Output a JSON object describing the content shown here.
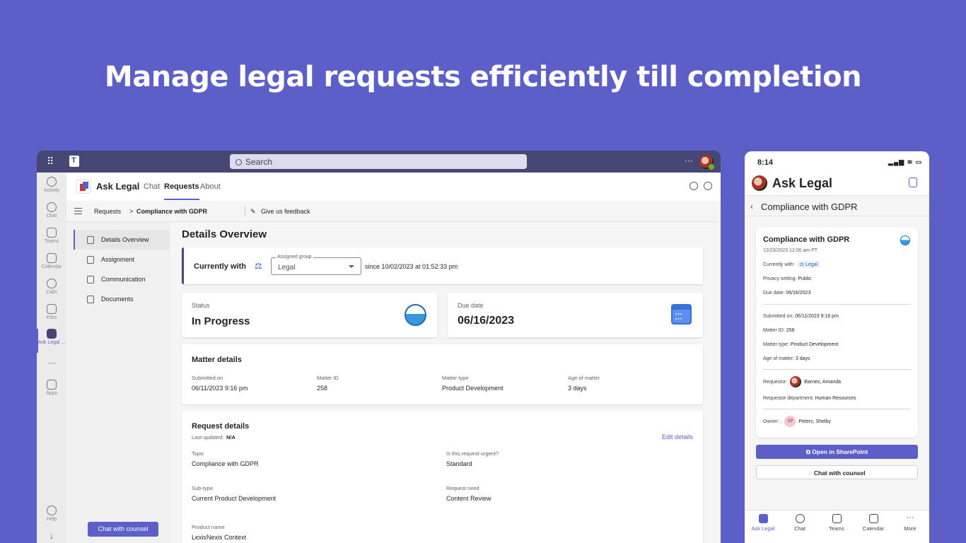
{
  "headline": "Manage legal requests efficiently till completion",
  "desktop": {
    "search_placeholder": "Search",
    "more": "···",
    "rail": [
      {
        "label": "Activity"
      },
      {
        "label": "Chat"
      },
      {
        "label": "Teams"
      },
      {
        "label": "Calendar"
      },
      {
        "label": "Calls"
      },
      {
        "label": "Files"
      },
      {
        "label": "Ask Legal ..."
      },
      {
        "label": "···"
      },
      {
        "label": "Apps"
      },
      {
        "label": "Help"
      }
    ],
    "app_title": "Ask Legal",
    "tabs": [
      "Chat",
      "Requests",
      "About"
    ],
    "breadcrumb": {
      "root": "Requests",
      "sep": ">",
      "current": "Compliance with GDPR",
      "feedback": "Give us feedback"
    },
    "nav": [
      "Details Overview",
      "Assignment",
      "Communication",
      "Documents"
    ],
    "chat_counsel": "Chat with counsel",
    "main_title": "Details Overview",
    "currently_with": {
      "label": "Currently with",
      "group_label": "Assigned group",
      "group_value": "Legal",
      "since": "since 10/02/2023 at 01:52:33 pm"
    },
    "status": {
      "label": "Status",
      "value": "In Progress"
    },
    "due": {
      "label": "Due date",
      "value": "06/16/2023"
    },
    "matter": {
      "title": "Matter details",
      "fields": [
        {
          "label": "Submitted on",
          "value": "06/11/2023 9:16 pm"
        },
        {
          "label": "Matter ID",
          "value": "258"
        },
        {
          "label": "Matter type",
          "value": "Product Development"
        },
        {
          "label": "Age of matter",
          "value": "3 days"
        }
      ]
    },
    "request": {
      "title": "Request details",
      "last_updated_label": "Last updated:",
      "last_updated_value": "N/A",
      "edit": "Edit details",
      "fields": [
        {
          "label": "Topic",
          "value": "Compliance with GDPR"
        },
        {
          "label": "Is this request urgent?",
          "value": "Standard"
        },
        {
          "label": "Sub-type",
          "value": "Current Product Development"
        },
        {
          "label": "Request need",
          "value": "Content Review"
        },
        {
          "label": "Product name",
          "value": "LexisNexis Context"
        }
      ]
    }
  },
  "phone": {
    "time": "8:14",
    "status_icons": "▂▄▆ ≋ ▭",
    "title": "Ask Legal",
    "subtitle": "Compliance with GDPR",
    "card": {
      "title": "Compliance with GDPR",
      "date": "12/23/2023 12:00 am PT",
      "currently_with_label": "Currently with:",
      "currently_with_value": "Legal",
      "privacy_label": "Privacy setting:",
      "privacy_value": "Public",
      "due_label": "Due date:",
      "due_value": "06/16/2023",
      "submitted_label": "Submitted on:",
      "submitted_value": "06/11/2023 9:16 pm",
      "matter_id_label": "Matter ID:",
      "matter_id_value": "258",
      "matter_type_label": "Matter type:",
      "matter_type_value": "Product Development",
      "age_label": "Age of matter:",
      "age_value": "3 days",
      "requestor_label": "Requestor:",
      "requestor_value": "Barnes, Amanda",
      "dept_label": "Requestor department:",
      "dept_value": "Human Resources",
      "owner_label": "Owner: .",
      "owner_initials": "SP",
      "owner_value": "Peters, Shelby"
    },
    "btn_sharepoint": "Open in SharePoint",
    "btn_chat": "Chat with counsel",
    "nav": [
      "Ask Legal",
      "Chat",
      "Teams",
      "Calendar",
      "More"
    ]
  }
}
